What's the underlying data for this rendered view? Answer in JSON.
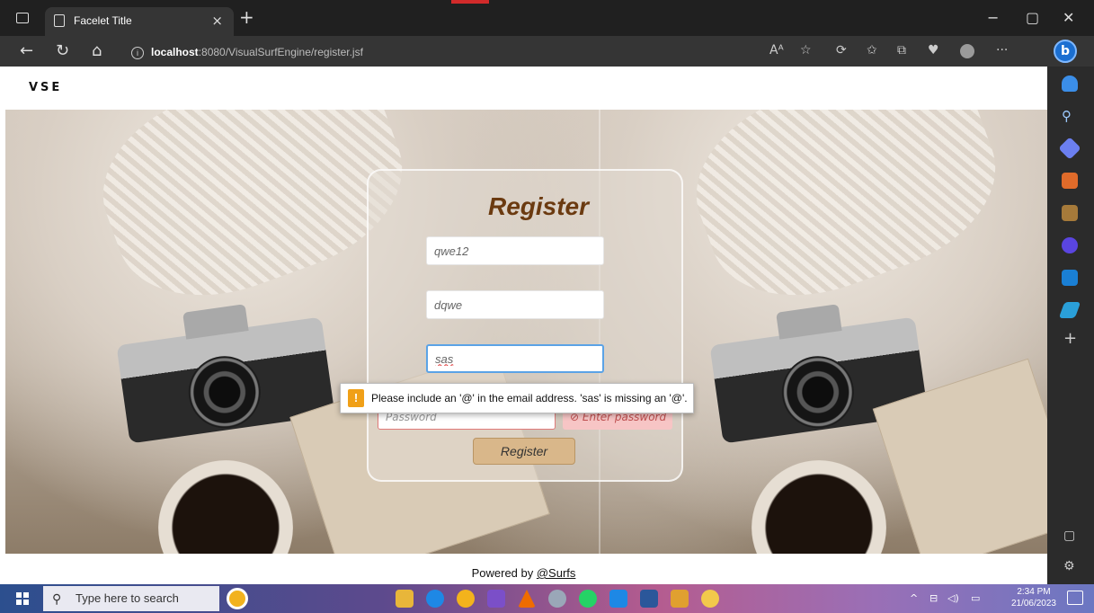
{
  "browser": {
    "tab_title": "Facelet Title",
    "tab_close": "×",
    "new_tab": "+",
    "url_host": "localhost",
    "url_rest": ":8080/VisualSurfEngine/register.jsf",
    "window_controls": [
      "−",
      "▢",
      "✕"
    ]
  },
  "page": {
    "logo": "VSE",
    "register": {
      "title": "Register",
      "username_value": "qwe12",
      "name_value": "dqwe",
      "email_value": "sas",
      "password_placeholder": "Password",
      "password_error": "Enter password",
      "submit_label": "Register"
    },
    "validation_tooltip": "Please include an '@' in the email address. 'sas' is missing an '@'.",
    "footer": {
      "prefix": "Powered by ",
      "link": "@Surfs"
    }
  },
  "taskbar": {
    "search_placeholder": "Type here to search",
    "time": "2:34 PM",
    "date": "21/06/2023"
  },
  "colors": {
    "title_brown": "#6b3a10",
    "button_tan": "#d9b78a",
    "focus_blue": "#5ba3e6",
    "warning_orange": "#f0a018"
  }
}
